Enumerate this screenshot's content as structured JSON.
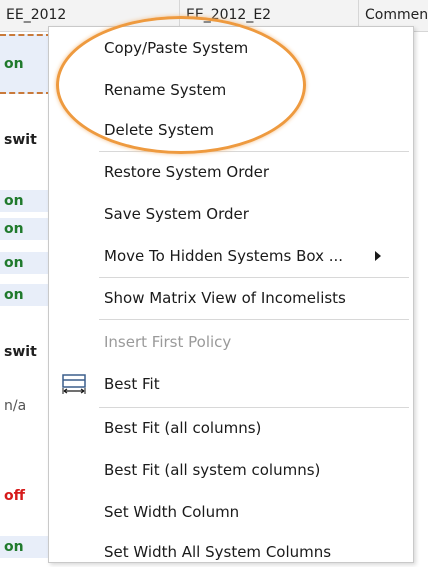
{
  "header": {
    "col1": "EE_2012",
    "col2": "EE_2012_E2",
    "col3": "Commen"
  },
  "left_cells": [
    {
      "text": "on"
    },
    {
      "text": "swit"
    },
    {
      "text": "on"
    },
    {
      "text": "on"
    },
    {
      "text": "on"
    },
    {
      "text": "on"
    },
    {
      "text": "swit"
    },
    {
      "text": "n/a"
    },
    {
      "text": "off"
    },
    {
      "text": "on"
    }
  ],
  "menu": {
    "items": [
      {
        "label": "Copy/Paste System"
      },
      {
        "label": "Rename System"
      },
      {
        "label": "Delete System"
      },
      {
        "label": "Restore System Order"
      },
      {
        "label": "Save System Order"
      },
      {
        "label": "Move To Hidden Systems Box ..."
      },
      {
        "label": "Show Matrix View of Incomelists"
      },
      {
        "label": "Insert First Policy"
      },
      {
        "label": "Best Fit"
      },
      {
        "label": "Best Fit (all columns)"
      },
      {
        "label": "Best Fit (all system columns)"
      },
      {
        "label": "Set Width Column"
      },
      {
        "label": "Set Width All System Columns"
      }
    ]
  },
  "icons": {
    "best_fit": "column-width-icon",
    "submenu": "chevron-right-icon"
  },
  "colors": {
    "highlight": "#ee9a3f",
    "on_text": "#207a2d",
    "off_text": "#d61a1a"
  }
}
